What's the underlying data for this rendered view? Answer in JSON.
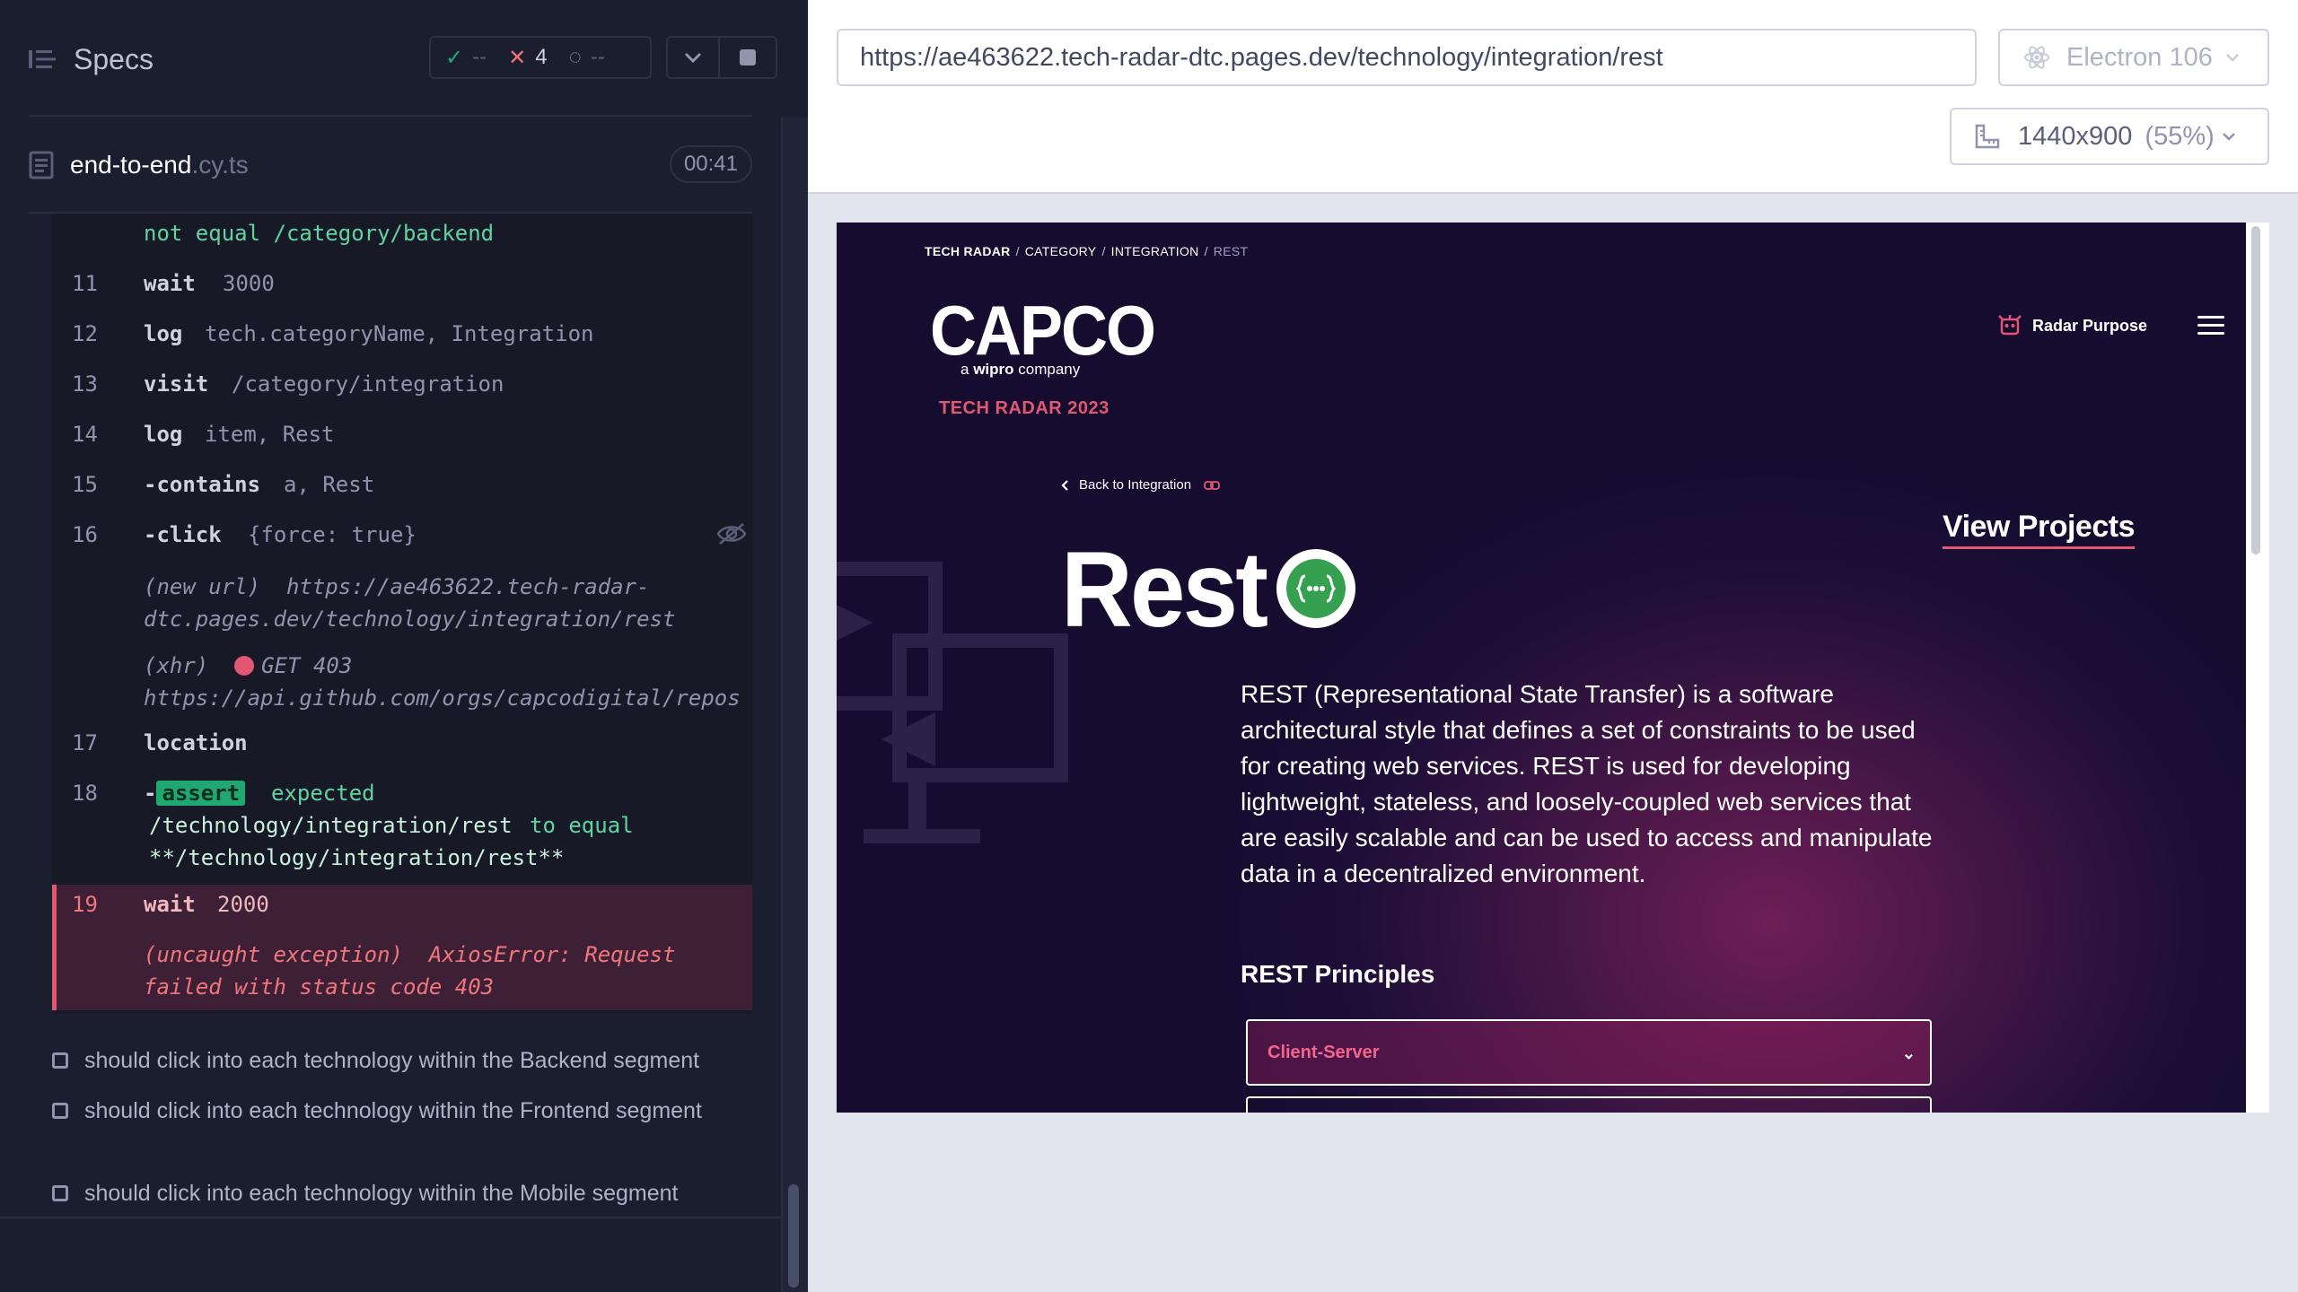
{
  "reporter": {
    "title": "Specs",
    "stats": {
      "passed": "--",
      "failed": "4",
      "pending": "--"
    },
    "spec_file": {
      "name": "end-to-end",
      "ext": ".cy.ts",
      "duration": "00:41"
    },
    "commands": [
      {
        "num": "",
        "name": "",
        "msg": "not equal  /category/backend"
      },
      {
        "num": "11",
        "name": "wait",
        "msg": "3000"
      },
      {
        "num": "12",
        "name": "log",
        "msg": "tech.categoryName, Integration"
      },
      {
        "num": "13",
        "name": "visit",
        "msg": "/category/integration"
      },
      {
        "num": "14",
        "name": "log",
        "msg": "item, Rest"
      },
      {
        "num": "15",
        "name": "-contains",
        "msg": "a, Rest"
      },
      {
        "num": "16",
        "name": "-click",
        "msg": "{force: true}"
      },
      {
        "num": "17",
        "name": "location",
        "msg": ""
      },
      {
        "num": "18",
        "name": "-",
        "msg": ""
      },
      {
        "num": "19",
        "name": "wait",
        "msg": "2000"
      }
    ],
    "new_url_label": "(new url)",
    "new_url_line1": "https://ae463622.tech-radar-",
    "new_url_line2": "dtc.pages.dev/technology/integration/rest",
    "xhr_label": "(xhr)",
    "xhr_status": "GET 403",
    "xhr_url": "https://api.github.com/orgs/capcodigital/repos",
    "assert_badge": "assert",
    "assert_expected": "expected",
    "assert_value": "/technology/integration/rest",
    "assert_to_equal": "to equal",
    "assert_target": "**/technology/integration/rest**",
    "error_label": "(uncaught exception)",
    "error_msg_1": "AxiosError: Request",
    "error_msg_2": "failed with status code 403",
    "pending_tests": [
      "should click into each technology within the Backend segment",
      "should click into each technology within the Frontend segment",
      "should click into each technology within the Mobile segment"
    ]
  },
  "browser": {
    "url": "https://ae463622.tech-radar-dtc.pages.dev/technology/integration/rest",
    "browser_name": "Electron 106",
    "viewport": "1440x900",
    "scale": "(55%)"
  },
  "app": {
    "breadcrumbs": [
      "TECH RADAR",
      "CATEGORY",
      "INTEGRATION",
      "REST"
    ],
    "logo": "CAPCO",
    "logo_sub_a": "a",
    "logo_sub_brand": "wipro",
    "logo_sub_rest": "company",
    "radar_year": "TECH RADAR 2023",
    "radar_purpose": "Radar Purpose",
    "back_link": "Back to Integration",
    "view_projects": "View Projects",
    "title": "Rest",
    "description": "REST (Representational State Transfer) is a software architectural style that defines a set of constraints to be used for creating web services. REST is used for developing lightweight, stateless, and loosely-coupled web services that are easily scalable and can be used to access and manipulate data in a decentralized environment.",
    "principles_title": "REST Principles",
    "principles": [
      "Client-Server"
    ]
  },
  "colors": {
    "accent_pink": "#e45770",
    "pass_green": "#1fa971",
    "reporter_bg": "#1b1e2e"
  }
}
